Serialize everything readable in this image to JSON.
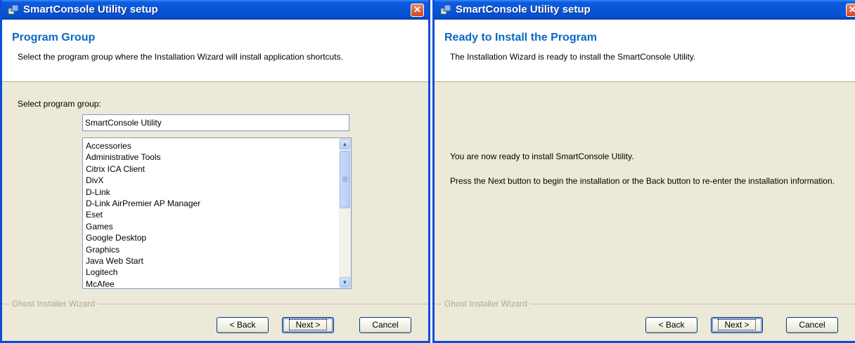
{
  "left_window": {
    "title": "SmartConsole Utility setup",
    "close_glyph": "✕",
    "header": {
      "title": "Program Group",
      "description": "Select the program group where the Installation Wizard will install application shortcuts."
    },
    "select_label": "Select program group:",
    "group_input_value": "SmartConsole Utility",
    "program_groups": [
      "Accessories",
      "Administrative Tools",
      "Citrix ICA Client",
      "DivX",
      "D-Link",
      "D-Link AirPremier AP Manager",
      "Eset",
      "Games",
      "Google Desktop",
      "Graphics",
      "Java Web Start",
      "Logitech",
      "McAfee"
    ],
    "footer_label": "Ghost Installer Wizard",
    "buttons": {
      "back": "< Back",
      "next": "Next >",
      "cancel": "Cancel"
    }
  },
  "right_window": {
    "title": "SmartConsole Utility setup",
    "close_glyph": "✕",
    "header": {
      "title": "Ready to Install the Program",
      "description": "The Installation Wizard is ready to install the SmartConsole Utility."
    },
    "ready_text": "You are now ready to install SmartConsole Utility.",
    "instruction_text": "Press the Next button to begin the installation or the Back button to re-enter the installation information.",
    "footer_label": "Ghost Installer Wizard",
    "buttons": {
      "back": "< Back",
      "next": "Next >",
      "cancel": "Cancel"
    }
  },
  "icons": {
    "app": "setup-app-icon",
    "close": "close-icon",
    "scroll_up": "scroll-up-arrow-icon",
    "scroll_down": "scroll-down-arrow-icon"
  },
  "colors": {
    "title_bar": "#0754d6",
    "header_title": "#0b68c4",
    "dialog_bg": "#ece9d8",
    "close_button": "#d3441e"
  }
}
